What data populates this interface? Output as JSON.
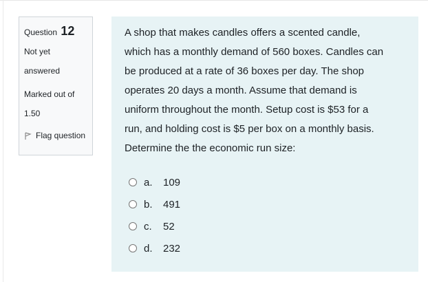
{
  "info": {
    "question_label": "Question",
    "question_number": "12",
    "state_line1": "Not yet",
    "state_line2": "answered",
    "grade_line1": "Marked out of",
    "grade_line2": "1.50",
    "flag_label": "Flag question",
    "flag_icon": "flag-icon"
  },
  "question": {
    "lines": [
      "A shop that makes candles offers a scented candle,",
      "which has a monthly demand of 560 boxes. Candles can",
      "be produced at a rate of 36 boxes per day. The shop",
      "operates 20 days a month. Assume that demand is",
      "uniform throughout the month. Setup cost is $53 for a",
      "run, and holding cost is $5 per box on a monthly basis.",
      "Determine the the economic run size:"
    ]
  },
  "answers": [
    {
      "letter": "a.",
      "value": "109"
    },
    {
      "letter": "b.",
      "value": "491"
    },
    {
      "letter": "c.",
      "value": "52"
    },
    {
      "letter": "d.",
      "value": "232"
    }
  ],
  "colors": {
    "info_bg": "#f8f9fa",
    "formulation_bg": "#e7f3f5",
    "text": "#1d2125"
  }
}
